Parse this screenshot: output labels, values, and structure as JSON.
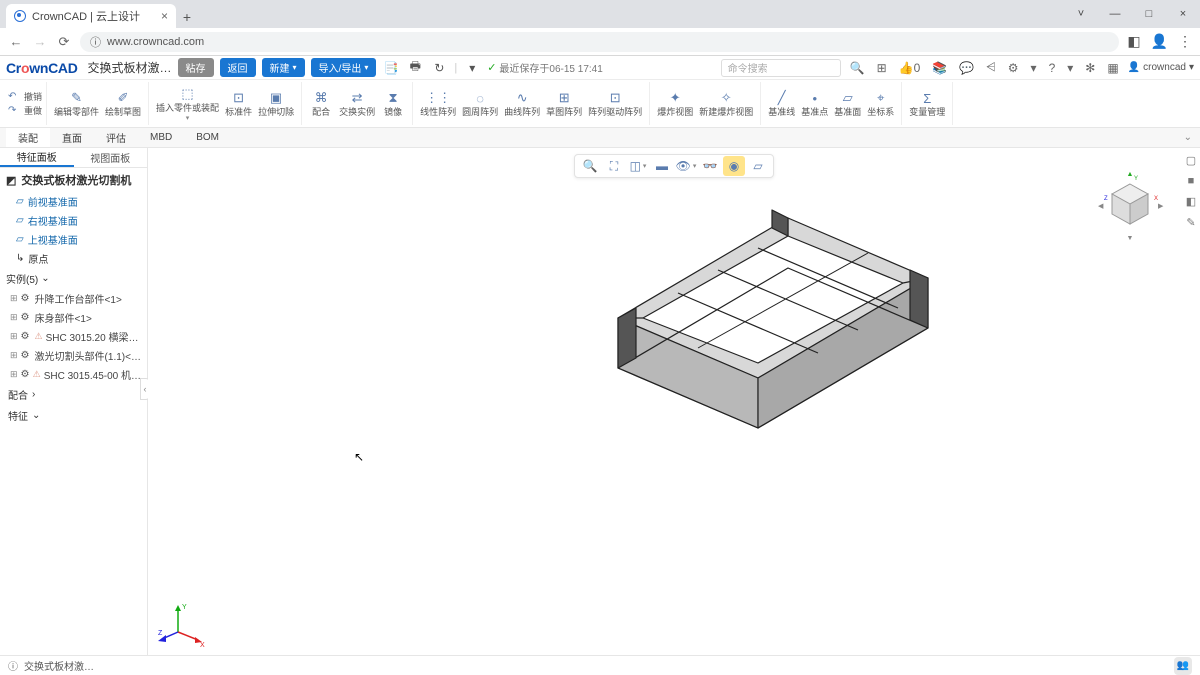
{
  "browser": {
    "tab_title": "CrownCAD | 云上设计",
    "url": "www.crowncad.com",
    "window_controls": {
      "min": "—",
      "max": "□",
      "close": "×"
    }
  },
  "header": {
    "logo_text": "CrownCAD",
    "doc_name": "交换式板材激…",
    "pills": {
      "save": "粘存",
      "back": "返回",
      "new": "新建",
      "import_export": "导入/导出"
    },
    "last_saved": "最近保存于06-15 17:41",
    "search_placeholder": "命令搜索",
    "like_count": "0",
    "user": "crowncad"
  },
  "ribbon": {
    "undo": "撤销",
    "redo": "重做",
    "edit_part": "编辑零部件",
    "draw_sketch": "绘制草图",
    "insert_part": "插入零件或装配",
    "standard_part": "标准件",
    "extrude_cut": "拉伸切除",
    "mate": "配合",
    "replace_inst": "交换实例",
    "mirror": "镜像",
    "linear_pat": "线性阵列",
    "circular_pat": "圆周阵列",
    "curve_pat": "曲线阵列",
    "sketch_pat": "草图阵列",
    "pattern_driven": "阵列驱动阵列",
    "exploded": "爆炸视图",
    "new_exploded": "新建爆炸视图",
    "ref_line": "基准线",
    "ref_point": "基准点",
    "ref_plane": "基准面",
    "coord_sys": "坐标系",
    "var_mgmt": "变量管理"
  },
  "sec_tabs": [
    "装配",
    "直面",
    "评估",
    "MBD",
    "BOM"
  ],
  "left_panel": {
    "tabs": [
      "特征面板",
      "视图面板"
    ],
    "root": "交换式板材激光切割机",
    "planes": [
      "前视基准面",
      "右视基准面",
      "上视基准面"
    ],
    "origin": "原点",
    "instances_label": "实例(5)",
    "instances": [
      {
        "name": "升降工作台部件<1>",
        "warn": false
      },
      {
        "name": "床身部件<1>",
        "warn": false
      },
      {
        "name": "SHC 3015.20 横梁…",
        "warn": true
      },
      {
        "name": "激光切割头部件(1.1)<…",
        "warn": false
      },
      {
        "name": "SHC 3015.45-00 机…",
        "warn": true
      }
    ],
    "mate": "配合",
    "feature": "特征"
  },
  "view_toolbar": {
    "zoom": "⊕",
    "fit": "⛶",
    "box": "◫",
    "section": "◫",
    "eye": "👁",
    "glasses": "👓",
    "ball": "◉",
    "plane": "▱"
  },
  "axes": {
    "x": "X",
    "y": "Y",
    "z": "Z"
  },
  "status": {
    "doc_ref": "交换式板材激…"
  }
}
